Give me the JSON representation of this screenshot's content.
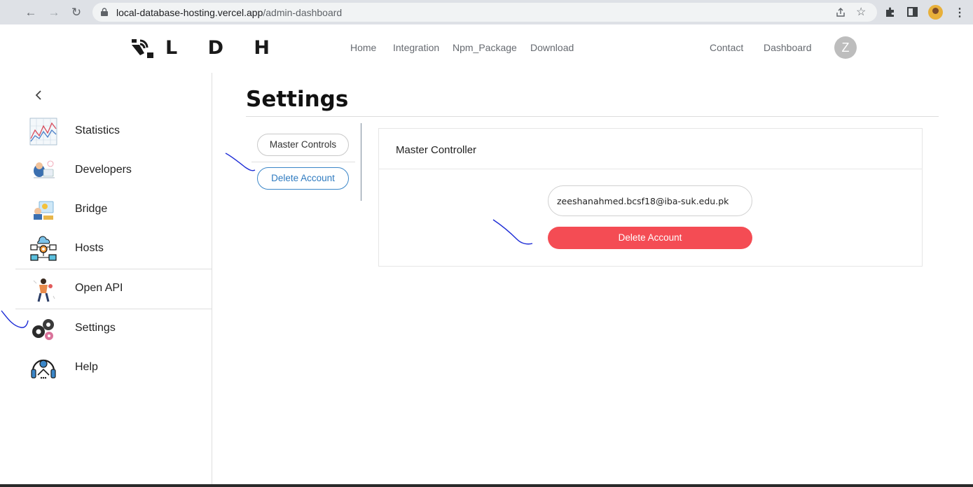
{
  "browser": {
    "url_host": "local-database-hosting.vercel.app",
    "url_path": "/admin-dashboard"
  },
  "header": {
    "logo_text": "L D H",
    "nav": [
      "Home",
      "Integration",
      "Npm_Package",
      "Download"
    ],
    "right_nav": [
      "Contact",
      "Dashboard"
    ],
    "avatar_letter": "Z"
  },
  "sidebar": {
    "items": [
      {
        "label": "Statistics",
        "icon": "statistics-icon"
      },
      {
        "label": "Developers",
        "icon": "developers-icon"
      },
      {
        "label": "Bridge",
        "icon": "bridge-icon"
      },
      {
        "label": "Hosts",
        "icon": "hosts-icon"
      },
      {
        "label": "Open API",
        "icon": "open-api-icon"
      },
      {
        "label": "Settings",
        "icon": "settings-icon"
      },
      {
        "label": "Help",
        "icon": "help-icon"
      }
    ]
  },
  "main": {
    "title": "Settings",
    "tabs": [
      "Master Controls",
      "Delete Account"
    ],
    "active_tab": "Delete Account",
    "card": {
      "title": "Master Controller",
      "email_value": "zeeshanahmed.bcsf18@iba-suk.edu.pk",
      "delete_label": "Delete Account"
    }
  },
  "colors": {
    "accent": "#2f7bc0",
    "danger": "#f44c54"
  }
}
